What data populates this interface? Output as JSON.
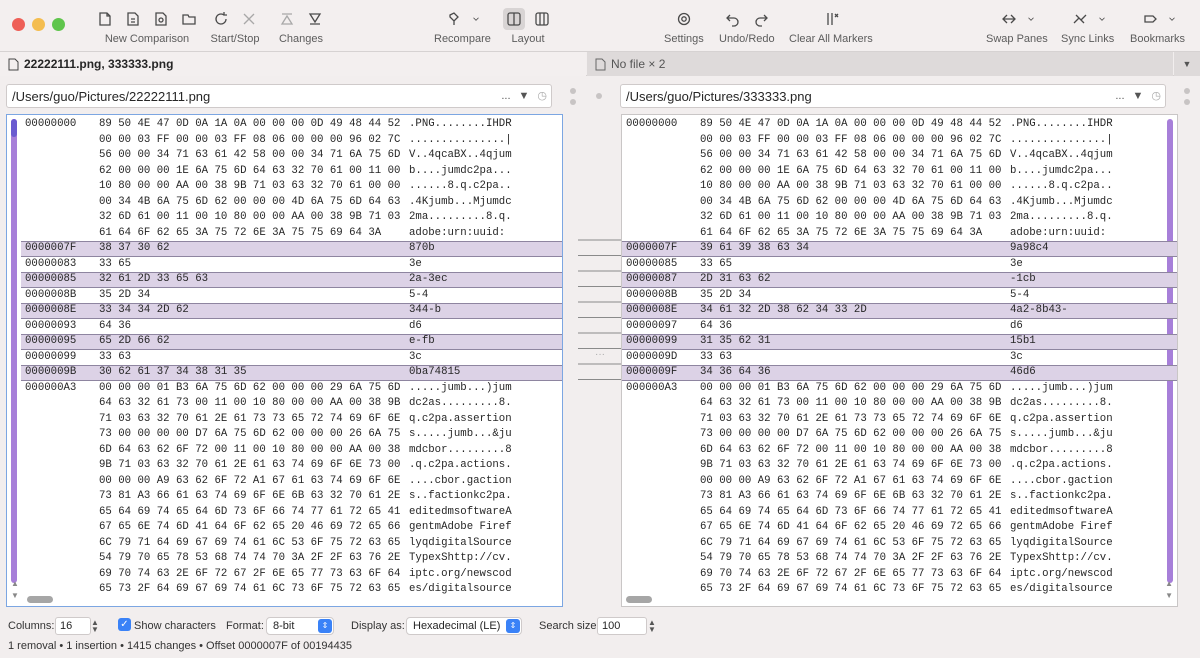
{
  "window": {
    "traffic": [
      "#ee5f57",
      "#f4bd4f",
      "#5fc54c"
    ]
  },
  "toolbar": {
    "new_comparison": "New Comparison",
    "start_stop": "Start/Stop",
    "changes": "Changes",
    "recompare": "Recompare",
    "layout": "Layout",
    "settings": "Settings",
    "undo_redo": "Undo/Redo",
    "clear_markers": "Clear All Markers",
    "swap_panes": "Swap Panes",
    "sync_links": "Sync Links",
    "bookmarks": "Bookmarks"
  },
  "tabs": {
    "active": "22222111.png, 333333.png",
    "inactive": "No file × 2"
  },
  "left": {
    "path": "/Users/guo/Pictures/22222111.png",
    "rows": [
      {
        "o": "00000000",
        "h": "89 50 4E 47 0D 0A 1A 0A 00 00 00 0D 49 48 44 52",
        "c": ".PNG........IHDR",
        "d": false
      },
      {
        "o": "",
        "h": "00 00 03 FF 00 00 03 FF 08 06 00 00 00 96 02 7C",
        "c": "...............|",
        "d": false
      },
      {
        "o": "",
        "h": "56 00 00 34 71 63 61 42 58 00 00 34 71 6A 75 6D",
        "c": "V..4qcaBX..4qjum",
        "d": false
      },
      {
        "o": "",
        "h": "62 00 00 00 1E 6A 75 6D 64 63 32 70 61 00 11 00",
        "c": "b....jumdc2pa...",
        "d": false
      },
      {
        "o": "",
        "h": "10 80 00 00 AA 00 38 9B 71 03 63 32 70 61 00 00",
        "c": "......8.q.c2pa..",
        "d": false
      },
      {
        "o": "",
        "h": "00 34 4B 6A 75 6D 62 00 00 00 4D 6A 75 6D 64 63",
        "c": ".4Kjumb...Mjumdc",
        "d": false
      },
      {
        "o": "",
        "h": "32 6D 61 00 11 00 10 80 00 00 AA 00 38 9B 71 03",
        "c": "2ma.........8.q.",
        "d": false
      },
      {
        "o": "",
        "h": "61 64 6F 62 65 3A 75 72 6E 3A 75 75 69 64 3A",
        "c": "adobe:urn:uuid:",
        "d": false
      },
      {
        "o": "0000007F",
        "h": "38 37 30 62",
        "c": "870b",
        "d": true
      },
      {
        "o": "00000083",
        "h": "33 65",
        "c": "3e",
        "d": false
      },
      {
        "o": "00000085",
        "h": "32 61 2D 33 65 63",
        "c": "2a-3ec",
        "d": true
      },
      {
        "o": "0000008B",
        "h": "35 2D 34",
        "c": "5-4",
        "d": false
      },
      {
        "o": "0000008E",
        "h": "33 34 34 2D 62",
        "c": "344-b",
        "d": true
      },
      {
        "o": "00000093",
        "h": "64 36",
        "c": "d6",
        "d": false
      },
      {
        "o": "00000095",
        "h": "65 2D 66 62",
        "c": "e-fb",
        "d": true
      },
      {
        "o": "00000099",
        "h": "33 63",
        "c": "3c",
        "d": false
      },
      {
        "o": "0000009B",
        "h": "30 62 61 37 34 38 31 35",
        "c": "0ba74815",
        "d": true
      },
      {
        "o": "000000A3",
        "h": "00 00 00 01 B3 6A 75 6D 62 00 00 00 29 6A 75 6D",
        "c": ".....jumb...)jum",
        "d": false
      },
      {
        "o": "",
        "h": "64 63 32 61 73 00 11 00 10 80 00 00 AA 00 38 9B",
        "c": "dc2as.........8.",
        "d": false
      },
      {
        "o": "",
        "h": "71 03 63 32 70 61 2E 61 73 73 65 72 74 69 6F 6E",
        "c": "q.c2pa.assertion",
        "d": false
      },
      {
        "o": "",
        "h": "73 00 00 00 00 D7 6A 75 6D 62 00 00 00 26 6A 75",
        "c": "s.....jumb...&ju",
        "d": false
      },
      {
        "o": "",
        "h": "6D 64 63 62 6F 72 00 11 00 10 80 00 00 AA 00 38",
        "c": "mdcbor.........8",
        "d": false
      },
      {
        "o": "",
        "h": "9B 71 03 63 32 70 61 2E 61 63 74 69 6F 6E 73 00",
        "c": ".q.c2pa.actions.",
        "d": false
      },
      {
        "o": "",
        "h": "00 00 00 A9 63 62 6F 72 A1 67 61 63 74 69 6F 6E",
        "c": "....cbor.gaction",
        "d": false
      },
      {
        "o": "",
        "h": "73 81 A3 66 61 63 74 69 6F 6E 6B 63 32 70 61 2E",
        "c": "s..factionkc2pa.",
        "d": false
      },
      {
        "o": "",
        "h": "65 64 69 74 65 64 6D 73 6F 66 74 77 61 72 65 41",
        "c": "editedmsoftwareA",
        "d": false
      },
      {
        "o": "",
        "h": "67 65 6E 74 6D 41 64 6F 62 65 20 46 69 72 65 66",
        "c": "gentmAdobe Firef",
        "d": false
      },
      {
        "o": "",
        "h": "6C 79 71 64 69 67 69 74 61 6C 53 6F 75 72 63 65",
        "c": "lyqdigitalSource",
        "d": false
      },
      {
        "o": "",
        "h": "54 79 70 65 78 53 68 74 74 70 3A 2F 2F 63 76 2E",
        "c": "TypexShttp://cv.",
        "d": false
      },
      {
        "o": "",
        "h": "69 70 74 63 2E 6F 72 67 2F 6E 65 77 73 63 6F 64",
        "c": "iptc.org/newscod",
        "d": false
      },
      {
        "o": "",
        "h": "65 73 2F 64 69 67 69 74 61 6C 73 6F 75 72 63 65",
        "c": "es/digitalsource",
        "d": false
      }
    ]
  },
  "right": {
    "path": "/Users/guo/Pictures/333333.png",
    "rows": [
      {
        "o": "00000000",
        "h": "89 50 4E 47 0D 0A 1A 0A 00 00 00 0D 49 48 44 52",
        "c": ".PNG........IHDR",
        "d": false
      },
      {
        "o": "",
        "h": "00 00 03 FF 00 00 03 FF 08 06 00 00 00 96 02 7C",
        "c": "...............|",
        "d": false
      },
      {
        "o": "",
        "h": "56 00 00 34 71 63 61 42 58 00 00 34 71 6A 75 6D",
        "c": "V..4qcaBX..4qjum",
        "d": false
      },
      {
        "o": "",
        "h": "62 00 00 00 1E 6A 75 6D 64 63 32 70 61 00 11 00",
        "c": "b....jumdc2pa...",
        "d": false
      },
      {
        "o": "",
        "h": "10 80 00 00 AA 00 38 9B 71 03 63 32 70 61 00 00",
        "c": "......8.q.c2pa..",
        "d": false
      },
      {
        "o": "",
        "h": "00 34 4B 6A 75 6D 62 00 00 00 4D 6A 75 6D 64 63",
        "c": ".4Kjumb...Mjumdc",
        "d": false
      },
      {
        "o": "",
        "h": "32 6D 61 00 11 00 10 80 00 00 AA 00 38 9B 71 03",
        "c": "2ma.........8.q.",
        "d": false
      },
      {
        "o": "",
        "h": "61 64 6F 62 65 3A 75 72 6E 3A 75 75 69 64 3A",
        "c": "adobe:urn:uuid:",
        "d": false
      },
      {
        "o": "0000007F",
        "h": "39 61 39 38 63 34",
        "c": "9a98c4",
        "d": true
      },
      {
        "o": "00000085",
        "h": "33 65",
        "c": "3e",
        "d": false
      },
      {
        "o": "00000087",
        "h": "2D 31 63 62",
        "c": "-1cb",
        "d": true
      },
      {
        "o": "0000008B",
        "h": "35 2D 34",
        "c": "5-4",
        "d": false
      },
      {
        "o": "0000008E",
        "h": "34 61 32 2D 38 62 34 33 2D",
        "c": "4a2-8b43-",
        "d": true
      },
      {
        "o": "00000097",
        "h": "64 36",
        "c": "d6",
        "d": false
      },
      {
        "o": "00000099",
        "h": "31 35 62 31",
        "c": "15b1",
        "d": true
      },
      {
        "o": "0000009D",
        "h": "33 63",
        "c": "3c",
        "d": false
      },
      {
        "o": "0000009F",
        "h": "34 36 64 36",
        "c": "46d6",
        "d": true
      },
      {
        "o": "000000A3",
        "h": "00 00 00 01 B3 6A 75 6D 62 00 00 00 29 6A 75 6D",
        "c": ".....jumb...)jum",
        "d": false
      },
      {
        "o": "",
        "h": "64 63 32 61 73 00 11 00 10 80 00 00 AA 00 38 9B",
        "c": "dc2as.........8.",
        "d": false
      },
      {
        "o": "",
        "h": "71 03 63 32 70 61 2E 61 73 73 65 72 74 69 6F 6E",
        "c": "q.c2pa.assertion",
        "d": false
      },
      {
        "o": "",
        "h": "73 00 00 00 00 D7 6A 75 6D 62 00 00 00 26 6A 75",
        "c": "s.....jumb...&ju",
        "d": false
      },
      {
        "o": "",
        "h": "6D 64 63 62 6F 72 00 11 00 10 80 00 00 AA 00 38",
        "c": "mdcbor.........8",
        "d": false
      },
      {
        "o": "",
        "h": "9B 71 03 63 32 70 61 2E 61 63 74 69 6F 6E 73 00",
        "c": ".q.c2pa.actions.",
        "d": false
      },
      {
        "o": "",
        "h": "00 00 00 A9 63 62 6F 72 A1 67 61 63 74 69 6F 6E",
        "c": "....cbor.gaction",
        "d": false
      },
      {
        "o": "",
        "h": "73 81 A3 66 61 63 74 69 6F 6E 6B 63 32 70 61 2E",
        "c": "s..factionkc2pa.",
        "d": false
      },
      {
        "o": "",
        "h": "65 64 69 74 65 64 6D 73 6F 66 74 77 61 72 65 41",
        "c": "editedmsoftwareA",
        "d": false
      },
      {
        "o": "",
        "h": "67 65 6E 74 6D 41 64 6F 62 65 20 46 69 72 65 66",
        "c": "gentmAdobe Firef",
        "d": false
      },
      {
        "o": "",
        "h": "6C 79 71 64 69 67 69 74 61 6C 53 6F 75 72 63 65",
        "c": "lyqdigitalSource",
        "d": false
      },
      {
        "o": "",
        "h": "54 79 70 65 78 53 68 74 74 70 3A 2F 2F 63 76 2E",
        "c": "TypexShttp://cv.",
        "d": false
      },
      {
        "o": "",
        "h": "69 70 74 63 2E 6F 72 67 2F 6E 65 77 73 63 6F 64",
        "c": "iptc.org/newscod",
        "d": false
      },
      {
        "o": "",
        "h": "65 73 2F 64 69 67 69 74 61 6C 73 6F 75 72 63 65",
        "c": "es/digitalsource",
        "d": false
      }
    ]
  },
  "bottom": {
    "columns_label": "Columns:",
    "columns_value": "16",
    "show_chars": "Show characters",
    "format_label": "Format:",
    "format_value": "8-bit",
    "display_label": "Display as:",
    "display_value": "Hexadecimal (LE)",
    "search_label": "Search size:",
    "search_value": "100"
  },
  "status": "1 removal • 1 insertion • 1415 changes • Offset 0000007F of 00194435",
  "misc": {
    "ellipsis": "...",
    "gutter_dots": "···"
  }
}
